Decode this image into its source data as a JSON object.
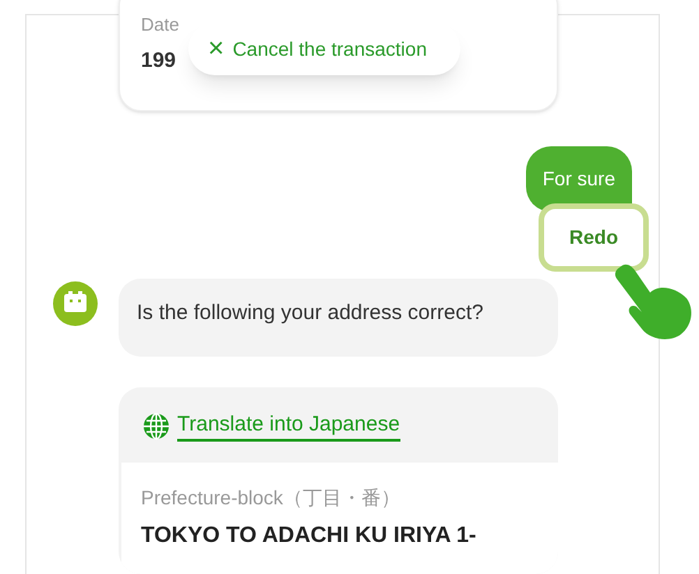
{
  "date_card": {
    "label": "Date",
    "value": "199"
  },
  "cancel_button": {
    "icon": "×",
    "label": "Cancel the transaction"
  },
  "user_message": {
    "text": "For sure"
  },
  "redo_button": {
    "label": "Redo"
  },
  "bot_message": {
    "text": "Is the following your address correct?"
  },
  "address_card": {
    "translate_link": "Translate into Japanese",
    "field_label": "Prefecture-block（丁目・番）",
    "field_value": "TOKYO TO ADACHI KU IRIYA 1-"
  }
}
